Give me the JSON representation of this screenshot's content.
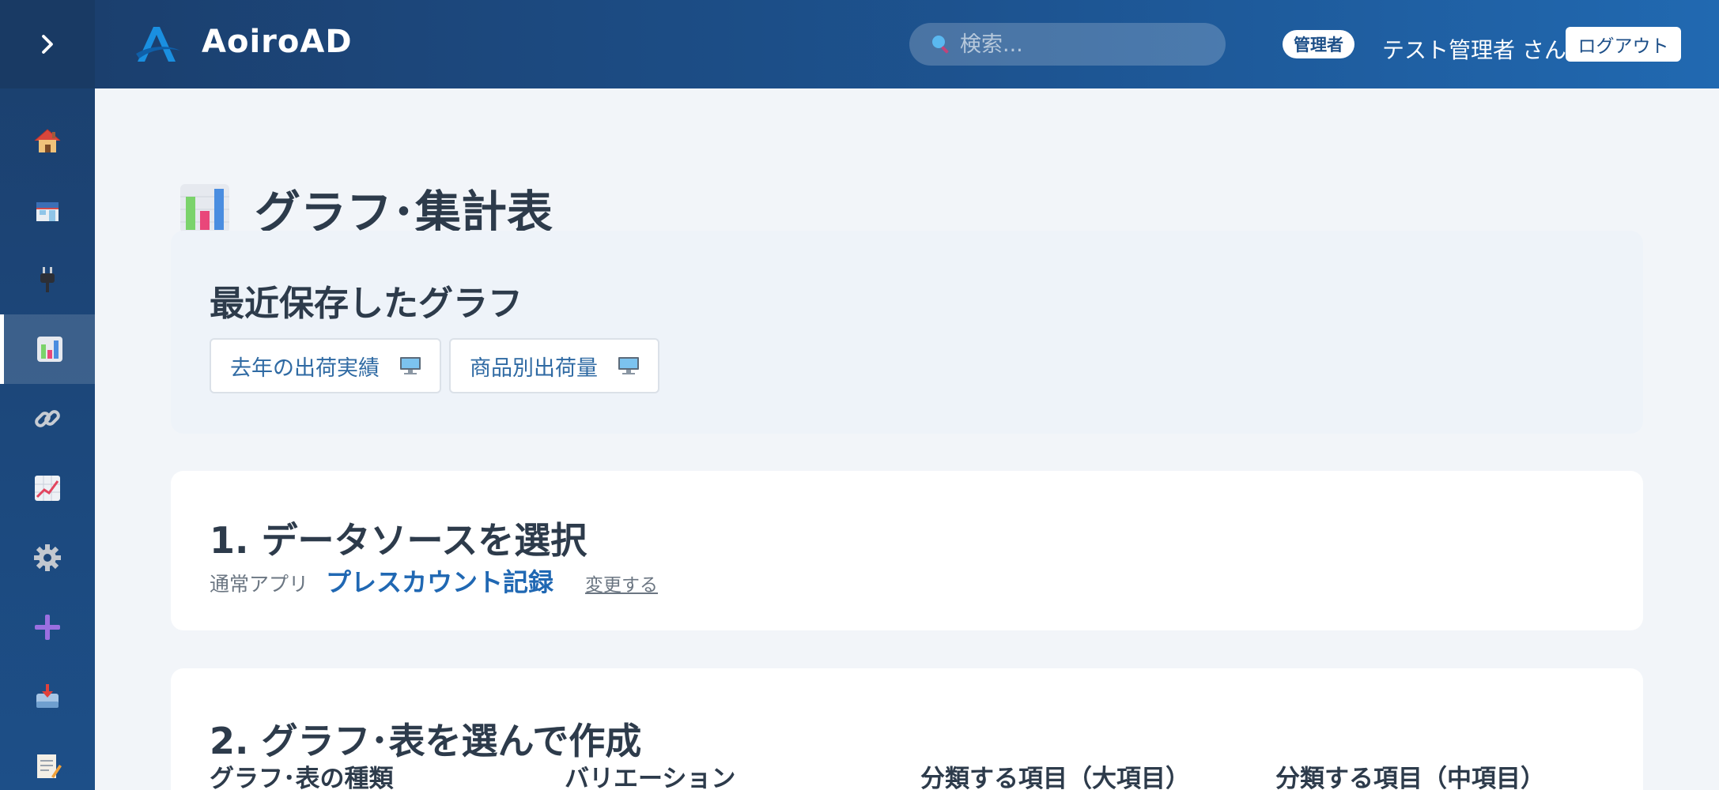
{
  "app": {
    "brand": "AoiroAD"
  },
  "header": {
    "search_placeholder": "検索...",
    "role_badge": "管理者",
    "user_name": "テスト管理者 さん",
    "logout_label": "ログアウト"
  },
  "sidebar": {
    "items": [
      {
        "icon": "home-icon"
      },
      {
        "icon": "store-icon"
      },
      {
        "icon": "plug-icon"
      },
      {
        "icon": "bar-chart-icon",
        "active": true
      },
      {
        "icon": "link-icon"
      },
      {
        "icon": "trend-chart-icon"
      },
      {
        "icon": "gear-icon"
      },
      {
        "icon": "plus-icon"
      },
      {
        "icon": "inbox-icon"
      },
      {
        "icon": "memo-icon"
      }
    ]
  },
  "page": {
    "title": "グラフ･集計表"
  },
  "recent": {
    "heading": "最近保存したグラフ",
    "items": [
      {
        "label": "去年の出荷実績",
        "icon": "desktop-icon"
      },
      {
        "label": "商品別出荷量",
        "icon": "desktop-icon"
      }
    ]
  },
  "step1": {
    "title": "1. データソースを選択",
    "source_type": "通常アプリ",
    "source_name": "プレスカウント記録",
    "change_label": "変更する"
  },
  "step2": {
    "title": "2. グラフ･表を選んで作成",
    "columns": [
      "グラフ･表の種類",
      "バリエーション",
      "分類する項目（大項目）",
      "分類する項目（中項目）"
    ]
  },
  "colors": {
    "sidebar_bg": "#1b3f6d",
    "header_bg": "#1d5593",
    "accent_link": "#2068b3",
    "page_bg": "#f2f5f9"
  }
}
